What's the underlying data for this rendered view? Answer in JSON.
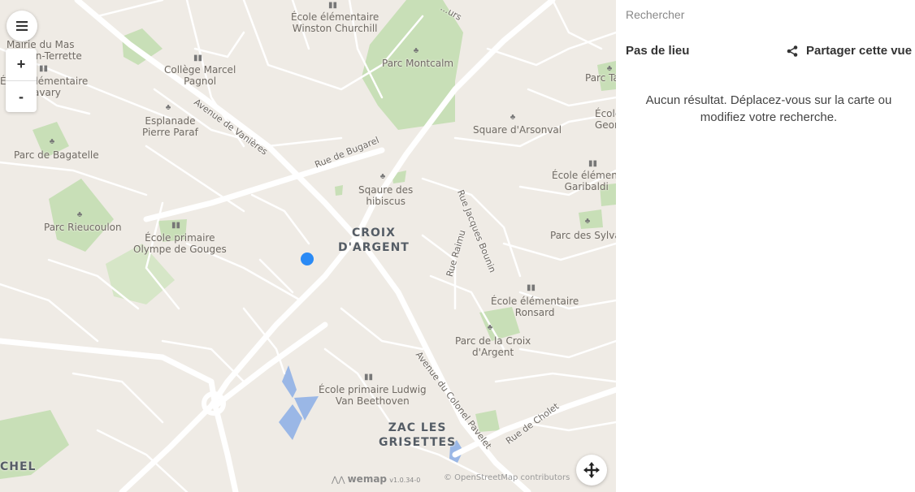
{
  "map": {
    "labels": {
      "ecole_winston": "École élémentaire\nWinston Churchill",
      "parc_montcalm": "Parc Montcalm",
      "college_pagnol": "Collège Marcel\nPagnol",
      "mas_terrette": "Mairie du Mas\nDrevon-Terrette",
      "ecole_savary": "École élémentaire\nSavary",
      "esplanade": "Esplanade\nPierre Paraf",
      "parc_bagatelle": "Parc de Bagatelle",
      "square_arsonval": "Square d'Arsonval",
      "ecole_georges": "École\nGeor",
      "parc_ta": "Parc Ta",
      "ecole_garibaldi": "École élément\nGaribaldi",
      "square_hibiscus": "Sqaure des\nhibiscus",
      "parc_rieucoulon": "Parc Rieucoulon",
      "ecole_olympe": "École primaire\nOlympe de Gouges",
      "croix_argent": "CROIX\nD'ARGENT",
      "parc_sylvains": "Parc des Sylvai",
      "ecole_ronsard": "École élémentaire\nRonsard",
      "parc_croix": "Parc de la Croix\nd'Argent",
      "ecole_beethoven": "École primaire Ludwig\nVan Beethoven",
      "zac_grisettes": "ZAC LES\nGRISETTES",
      "chel": "CHEL",
      "top_street": "...urs",
      "top_right": "...o..."
    },
    "streets": {
      "vanieres": "Avenue de Vanières",
      "bugarel": "Rue de Bugarel",
      "jacques_bounin": "Rue Jacques Bounin",
      "raimu": "Rue Raimu",
      "colonel_pavelet": "Avenue du Colonel Pavelet",
      "cholet": "Rue de Cholet"
    },
    "attribution": {
      "brand": "wemap",
      "version": "v1.0.34-0",
      "osm": "© OpenStreetMap contributors"
    },
    "controls": {
      "zoom_in": "+",
      "zoom_out": "-"
    },
    "colors": {
      "park": "#c8dfb7",
      "water": "#9ab7e6",
      "road": "#ffffff",
      "land": "#efebe5",
      "user_location": "#2a8af5"
    }
  },
  "panel": {
    "search_placeholder": "Rechercher",
    "no_place": "Pas de lieu",
    "share_label": "Partager cette vue",
    "no_result": "Aucun résultat. Déplacez-vous sur la carte ou modifiez votre recherche."
  }
}
